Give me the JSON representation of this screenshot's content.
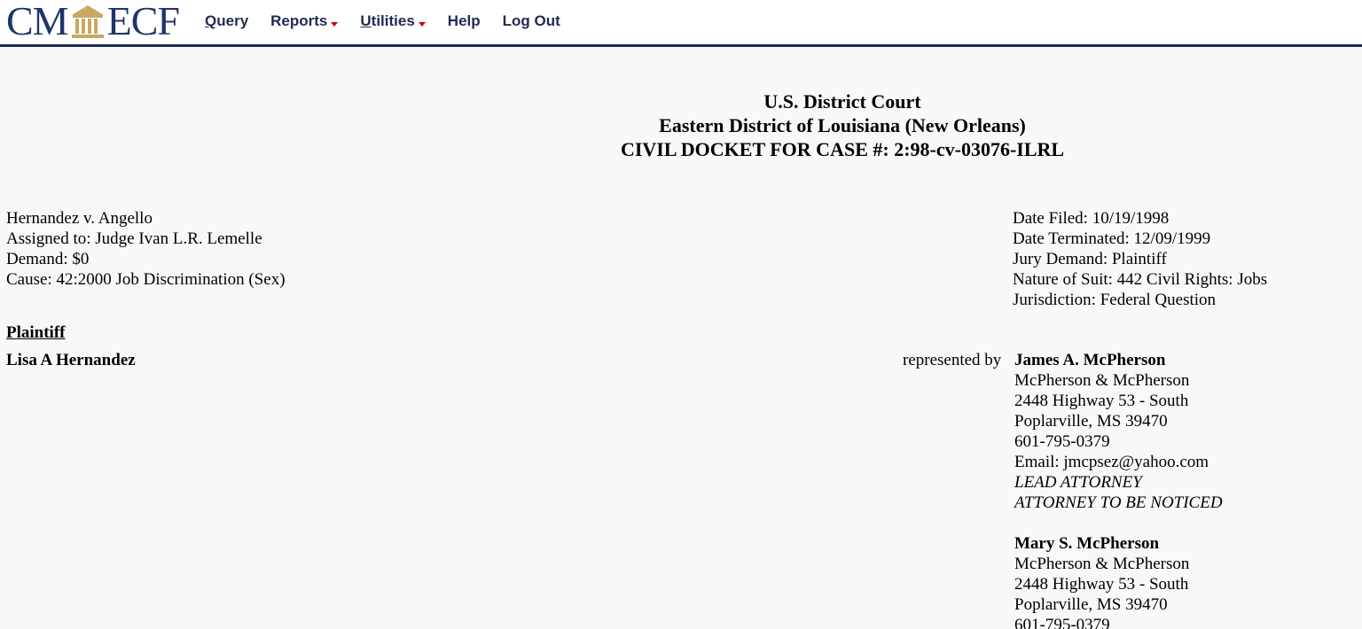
{
  "logo": {
    "left_text": "CM",
    "right_text": "ECF",
    "brand_color": "#1f3469",
    "accent_color": "#c9a961"
  },
  "nav": {
    "items": [
      {
        "label_ul": "Q",
        "label_rest": "uery",
        "has_caret": false
      },
      {
        "label_ul": "",
        "label_rest": "Reports",
        "has_caret": true
      },
      {
        "label_ul": "U",
        "label_rest": "tilities",
        "has_caret": true
      },
      {
        "label_ul": "",
        "label_rest": "Help",
        "has_caret": false
      },
      {
        "label_ul": "",
        "label_rest": "Log Out",
        "has_caret": false
      }
    ],
    "caret_color": "#d40000"
  },
  "header": {
    "court": "U.S. District Court",
    "district": "Eastern District of Louisiana (New Orleans)",
    "docket": "CIVIL DOCKET FOR CASE #: 2:98-cv-03076-ILRL"
  },
  "case": {
    "left": [
      "Hernandez v. Angello",
      "Assigned to: Judge Ivan L.R. Lemelle",
      "Demand: $0",
      "Cause: 42:2000 Job Discrimination (Sex)"
    ],
    "right": [
      "Date Filed: 10/19/1998",
      "Date Terminated: 12/09/1999",
      "Jury Demand: Plaintiff",
      "Nature of Suit: 442 Civil Rights: Jobs",
      "Jurisdiction: Federal Question"
    ]
  },
  "party": {
    "role": "Plaintiff",
    "name": "Lisa A Hernandez",
    "represented_by": "represented by"
  },
  "attorneys": [
    {
      "name": "James A. McPherson",
      "lines": [
        "McPherson & McPherson",
        "2448 Highway 53 - South",
        "Poplarville, MS 39470",
        "601-795-0379",
        "Email: jmcpsez@yahoo.com"
      ],
      "notes": [
        "LEAD ATTORNEY",
        "ATTORNEY TO BE NOTICED"
      ]
    },
    {
      "name": "Mary S. McPherson",
      "lines": [
        "McPherson & McPherson",
        "2448 Highway 53 - South",
        "Poplarville, MS 39470",
        "601-795-0379"
      ],
      "notes": []
    }
  ]
}
